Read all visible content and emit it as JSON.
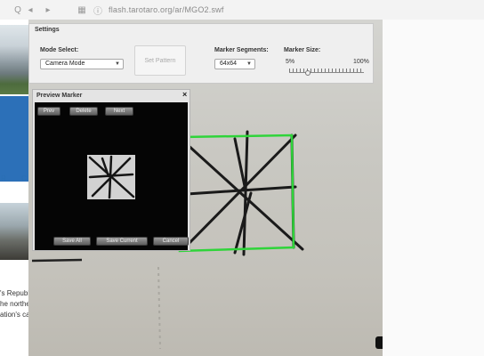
{
  "browser": {
    "search_glyph": "Q",
    "back_glyph": "◂",
    "forward_glyph": "▸",
    "tabs_glyph": "▦",
    "info_glyph": "ⓘ",
    "url": "flash.tarotaro.org/ar/MGO2.swf"
  },
  "left_page": {
    "link_a": "R",
    "link_b": "C",
    "text_lines": [
      "'s Republ",
      "he northe",
      "ation's ca"
    ]
  },
  "settings": {
    "title": "Settings",
    "mode_label": "Mode Select:",
    "mode_value": "Camera Mode",
    "set_pattern_label": "Set Pattern",
    "segments_label": "Marker Segments:",
    "segments_value": "64x64",
    "size_label": "Marker Size:",
    "size_min": "5%",
    "size_max": "100%",
    "size_value_fraction": 0.25
  },
  "preview": {
    "title": "Preview Marker",
    "close": "×",
    "prev_label": "Prev",
    "delete_label": "Delete",
    "next_label": "Next",
    "save_all_label": "Save All",
    "save_current_label": "Save Current",
    "cancel_label": "Cancel"
  },
  "colors": {
    "detected_square": "#2fd43a",
    "marker_ink": "#1a1a1a"
  }
}
